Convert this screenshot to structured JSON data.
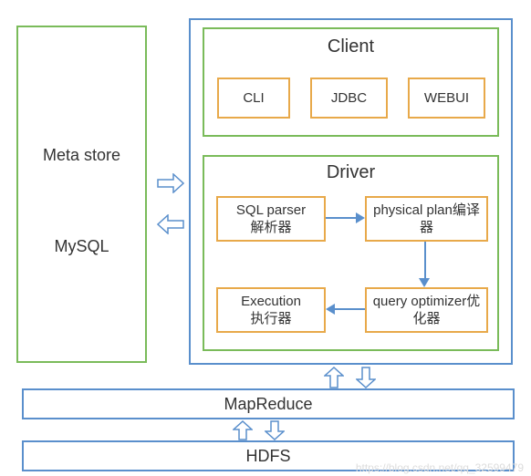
{
  "left": {
    "title1": "Meta store",
    "title2": "MySQL"
  },
  "client": {
    "title": "Client",
    "items": [
      "CLI",
      "JDBC",
      "WEBUI"
    ]
  },
  "driver": {
    "title": "Driver",
    "sql_parser": "SQL parser\n解析器",
    "physical_plan": "physical plan编译器",
    "query_optimizer": "query optimizer优化器",
    "execution": "Execution\n执行器"
  },
  "bottom": {
    "mapreduce": "MapReduce",
    "hdfs": "HDFS"
  },
  "watermark": "https://blog.csdn.net/qq_32599479"
}
